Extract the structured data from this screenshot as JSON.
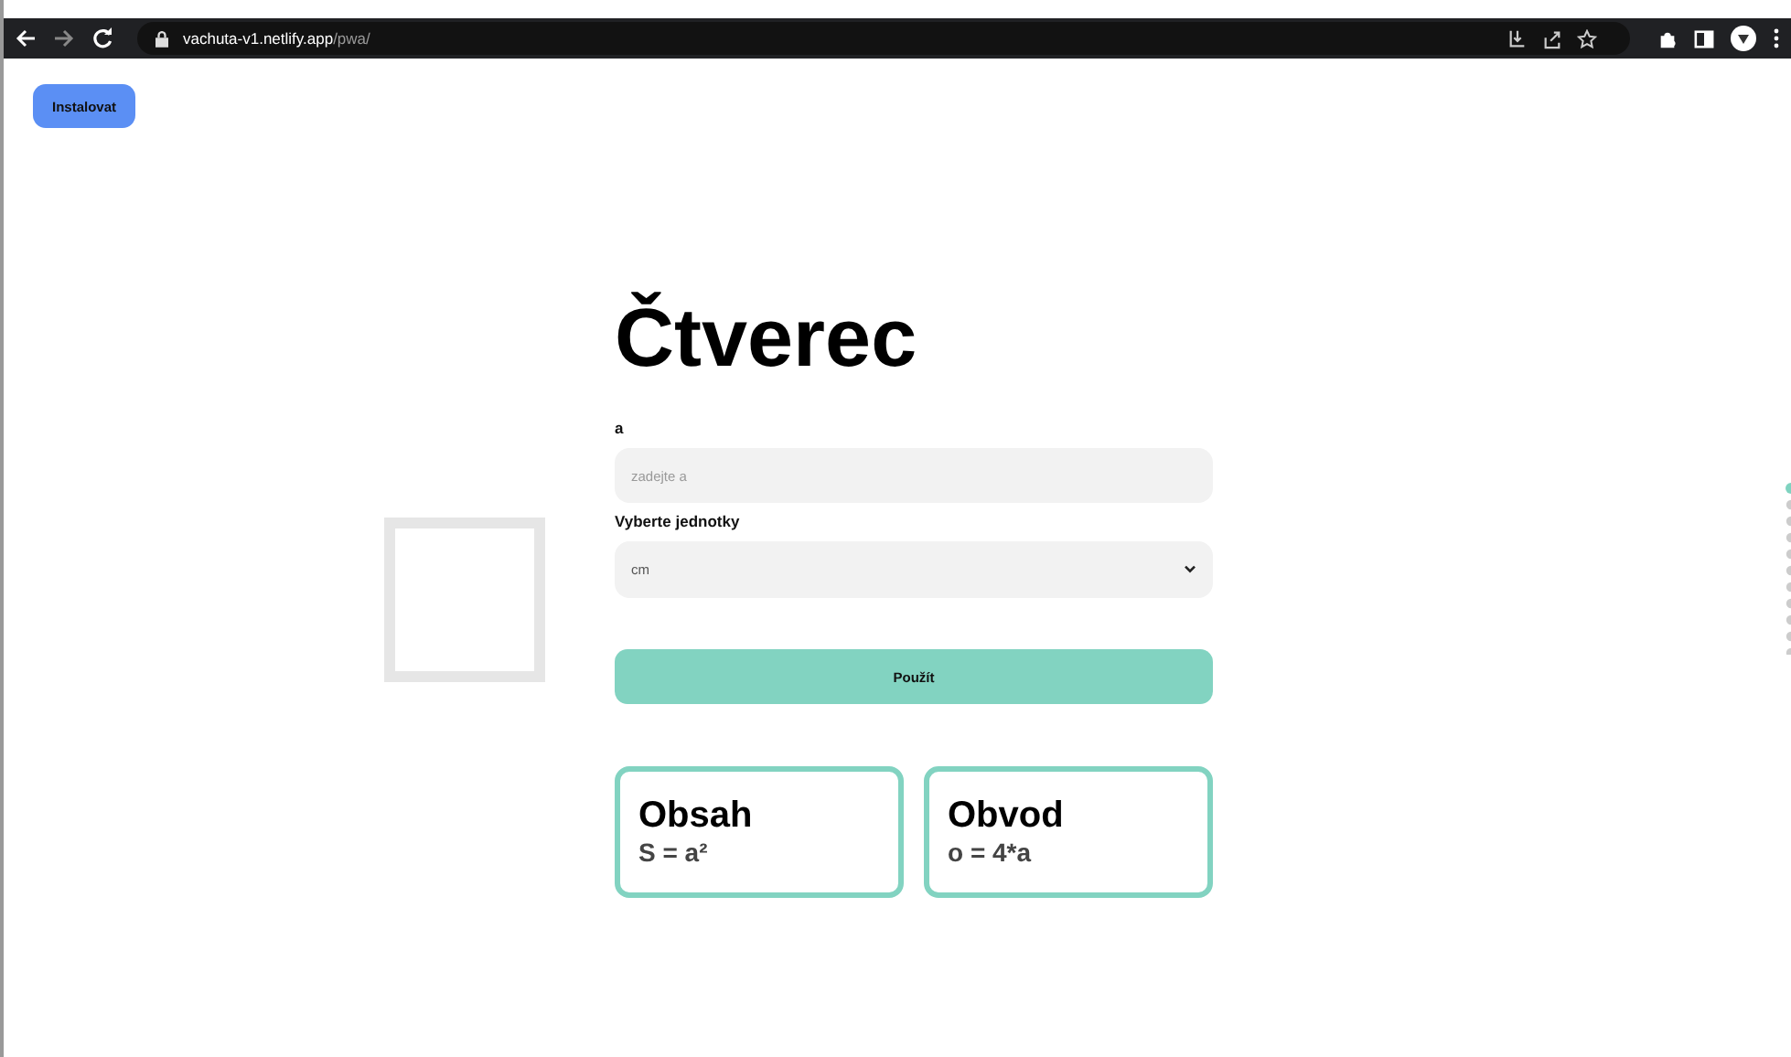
{
  "browser": {
    "url_host": "vachuta-v1.netlify.app",
    "url_path": "/pwa/"
  },
  "install_button": "Instalovat",
  "title": "Čtverec",
  "form": {
    "side_label": "a",
    "side_placeholder": "zadejte a",
    "unit_label": "Vyberte jednotky",
    "unit_value": "cm",
    "submit": "Použít"
  },
  "cards": [
    {
      "title": "Obsah",
      "formula": "S = a²"
    },
    {
      "title": "Obvod",
      "formula": "o = 4*a"
    }
  ]
}
